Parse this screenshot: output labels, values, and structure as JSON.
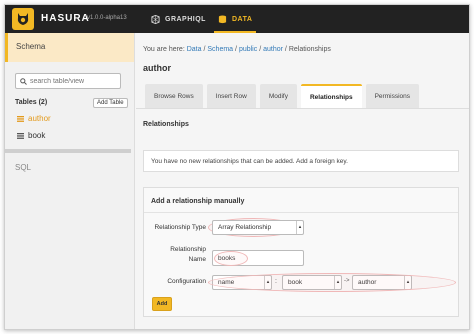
{
  "app": {
    "brand": "HASURA",
    "version": "v1.0.0-alpha13",
    "accent_color": "#f2b824"
  },
  "nav": {
    "graphiql_label": "GRAPHIQL",
    "data_label": "DATA"
  },
  "sidebar": {
    "schema_label": "Schema",
    "search_placeholder": "search table/view",
    "tables_label": "Tables (2)",
    "add_table_label": "Add Table",
    "tables": [
      {
        "name": "author",
        "active": true
      },
      {
        "name": "book",
        "active": false
      }
    ],
    "sql_label": "SQL"
  },
  "breadcrumb": {
    "prefix": "You are here:",
    "items": [
      "Data",
      "Schema",
      "public",
      "author",
      "Relationships"
    ],
    "separator": "/"
  },
  "page_title": "author",
  "tabs": [
    {
      "label": "Browse Rows",
      "active": false
    },
    {
      "label": "Insert Row",
      "active": false
    },
    {
      "label": "Modify",
      "active": false
    },
    {
      "label": "Relationships",
      "active": true
    },
    {
      "label": "Permissions",
      "active": false
    }
  ],
  "relationships": {
    "heading": "Relationships",
    "notice": "You have no new relationships that can be added. Add a foreign key."
  },
  "manual": {
    "title": "Add a relationship manually",
    "type_label": "Relationship Type",
    "type_value": "Array Relationship",
    "name_label_1": "Relationship",
    "name_label_2": "Name",
    "name_value": "books",
    "config_label": "Configuration",
    "column_value": "name",
    "colon": ":",
    "ref_table_value": "book",
    "arrow": "->",
    "ref_column_value": "author",
    "add_label": "Add"
  }
}
